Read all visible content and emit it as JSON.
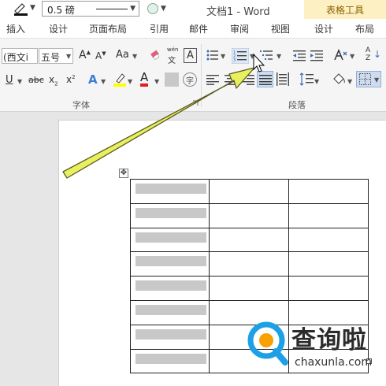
{
  "titlebar": {
    "line_weight": "0.5 磅",
    "doc_title": "文档1 - Word",
    "contextual_group": "表格工具"
  },
  "tabs": [
    {
      "label": "插入"
    },
    {
      "label": "设计"
    },
    {
      "label": "页面布局"
    },
    {
      "label": "引用"
    },
    {
      "label": "邮件"
    },
    {
      "label": "审阅"
    },
    {
      "label": "视图"
    },
    {
      "label": "设计"
    },
    {
      "label": "布局"
    }
  ],
  "ribbon": {
    "font": {
      "name": "(西文i",
      "size": "五号",
      "grow_label": "A",
      "shrink_label": "A",
      "case_label": "Aa",
      "phonetic_top": "wén",
      "phonetic_bottom": "文",
      "border_char": "A",
      "underline": "U",
      "strike": "abc",
      "subscript": "x",
      "subscript_digit": "2",
      "superscript": "x",
      "superscript_digit": "2",
      "effects": "A",
      "font_color": "A",
      "enclose": "字",
      "group_label": "字体"
    },
    "paragraph": {
      "group_label": "段落",
      "sort_glyph": "A",
      "sort_glyph2": "Z"
    },
    "colors": {
      "highlight": "#ffff00",
      "font_color": "#e02020",
      "arrow": "#e8f060"
    }
  },
  "table": {
    "rows": 8,
    "cols": 3
  },
  "watermark": {
    "brand": "查询啦",
    "url": "chaxunla.com"
  }
}
